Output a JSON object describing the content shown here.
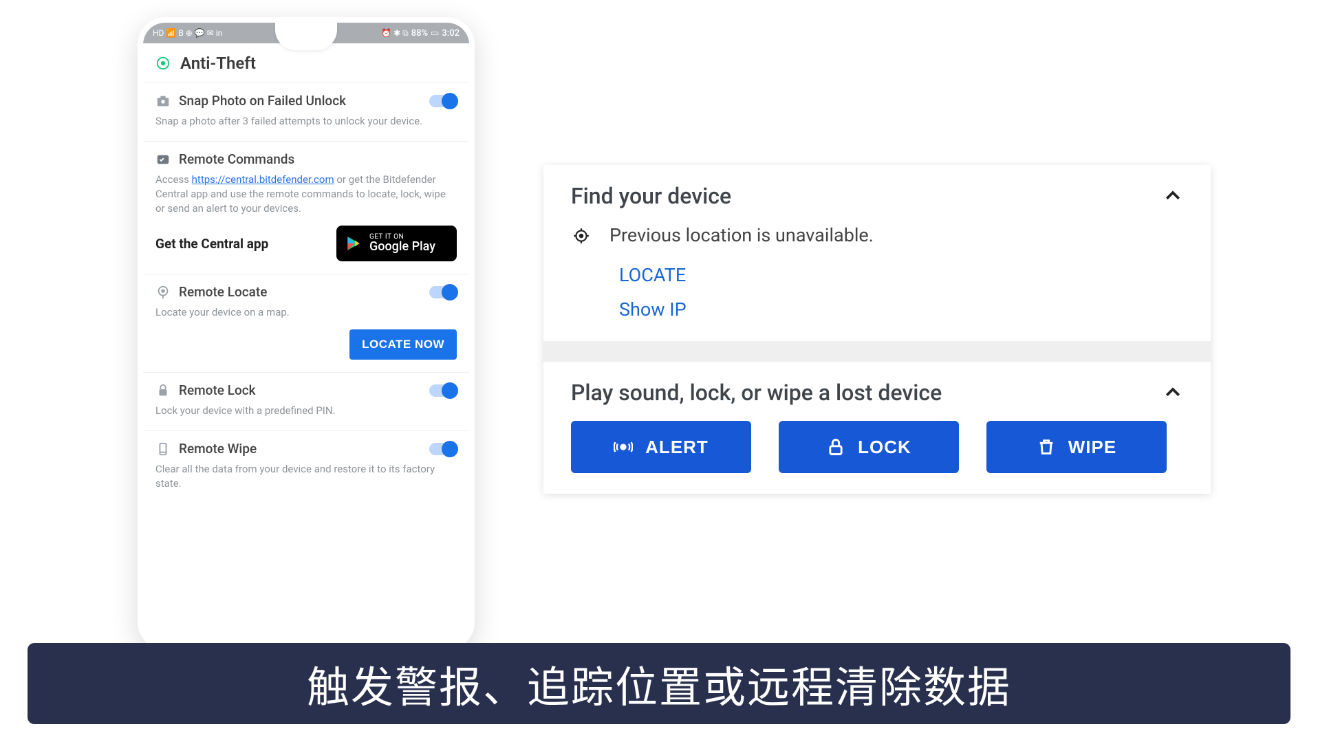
{
  "statusbar": {
    "left_icons": "HD 📶 B ⊕ 💬 ✉ in",
    "battery": "88%",
    "time": "3:02",
    "right_icons": "⏰ ✱ ⧉"
  },
  "app": {
    "title": "Anti-Theft"
  },
  "snap": {
    "title": "Snap Photo on Failed Unlock",
    "desc": "Snap a photo after 3 failed attempts to unlock your device."
  },
  "remote_commands": {
    "title": "Remote Commands",
    "prefix": "Access ",
    "link": "https://central.bitdefender.com",
    "suffix": " or get the Bitdefender Central app and use the remote commands to locate, lock, wipe or send an alert to your devices.",
    "get_app": "Get the Central app",
    "play_small": "GET IT ON",
    "play_big": "Google Play"
  },
  "remote_locate": {
    "title": "Remote Locate",
    "desc": "Locate your device on a map.",
    "button": "LOCATE NOW"
  },
  "remote_lock": {
    "title": "Remote Lock",
    "desc": "Lock your device with a predefined PIN."
  },
  "remote_wipe": {
    "title": "Remote Wipe",
    "desc": "Clear all the data from your device and restore it to its factory state."
  },
  "find": {
    "title": "Find your device",
    "message": "Previous location is unavailable.",
    "locate": "LOCATE",
    "show_ip": "Show IP"
  },
  "play": {
    "title": "Play sound, lock, or wipe a lost device",
    "alert": "ALERT",
    "lock": "LOCK",
    "wipe": "WIPE"
  },
  "banner": {
    "text": "触发警报、追踪位置或远程清除数据"
  }
}
